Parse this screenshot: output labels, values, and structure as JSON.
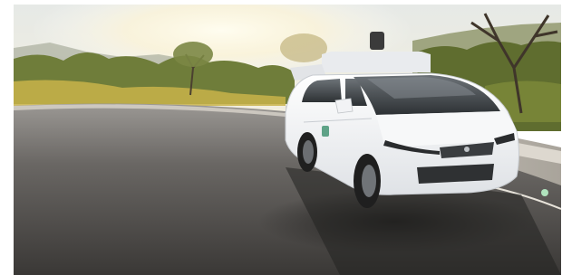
{
  "image": {
    "alt": "",
    "colors": {
      "sky": "#eef0ea",
      "sun": "#fffbe6",
      "road": "#4a4846",
      "car_body": "#f4f5f6",
      "vegetation": "#6f7d3a",
      "road_edge": "#b7b3ad"
    }
  }
}
